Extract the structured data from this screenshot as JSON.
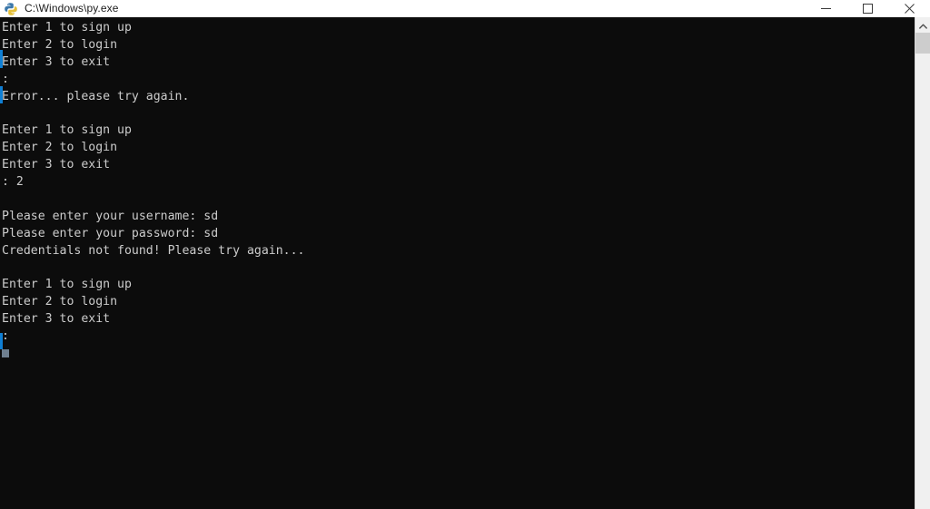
{
  "window": {
    "title": "C:\\Windows\\py.exe",
    "icon": "python-icon",
    "controls": {
      "minimize_label": "Minimize",
      "maximize_label": "Maximize",
      "close_label": "Close"
    }
  },
  "console": {
    "colors": {
      "background": "#0c0c0c",
      "foreground": "#cccccc",
      "accent": "#0f7fd4"
    },
    "lines": [
      "Enter 1 to sign up",
      "Enter 2 to login",
      "Enter 3 to exit",
      ":",
      "Error... please try again.",
      "",
      "Enter 1 to sign up",
      "Enter 2 to login",
      "Enter 3 to exit",
      ": 2",
      "",
      "Please enter your username: sd",
      "Please enter your password: sd",
      "Credentials not found! Please try again...",
      "",
      "Enter 1 to sign up",
      "Enter 2 to login",
      "Enter 3 to exit",
      ":",
      ""
    ]
  },
  "scrollbar": {
    "up_arrow": "chevron-up-icon",
    "position": "top"
  }
}
